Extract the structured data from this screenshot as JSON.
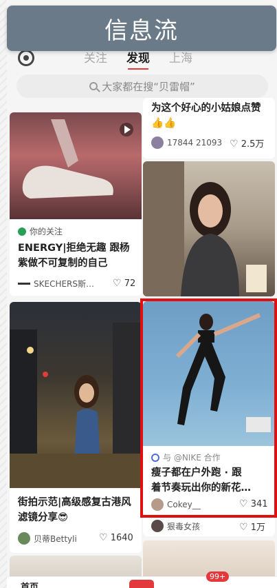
{
  "banner": {
    "title": "信息流"
  },
  "nav": {
    "tabs": [
      "关注",
      "发现",
      "上海"
    ],
    "active": 1
  },
  "search": {
    "placeholder": "大家都在搜“贝雷帽”"
  },
  "cards": {
    "top_right": {
      "title": "为这个好心的小姑娘点赞",
      "emoji": "👍👍",
      "author": "17844 21093",
      "likes": "2.5万"
    },
    "shoe": {
      "tag": "你的关注",
      "title_line1": "ENERGY|拒绝无趣 跟杨",
      "title_line2": "紫做不可复制的自己",
      "author": "SKECHERS斯…",
      "likes": "72"
    },
    "nike": {
      "tag": "与 @NIKE 合作",
      "title_line1": "瘦子都在户外跑 · 跟",
      "title_line2": "着节奏玩出你的新花…",
      "author": "Cokey__",
      "likes": "341"
    },
    "street": {
      "title_line1": "街拍示范|高级感复古港风",
      "title_line2": "滤镜分享😎",
      "author": "贝蒂Bettyli",
      "likes": "1640"
    },
    "bottom_right": {
      "author": "狠毒女孩",
      "likes": "1万"
    }
  },
  "bottom_bar": {
    "home": "首页",
    "badge": "99+"
  },
  "colors": {
    "accent": "#e4393c",
    "highlight": "#e01010",
    "banner": "#6a7a88"
  }
}
